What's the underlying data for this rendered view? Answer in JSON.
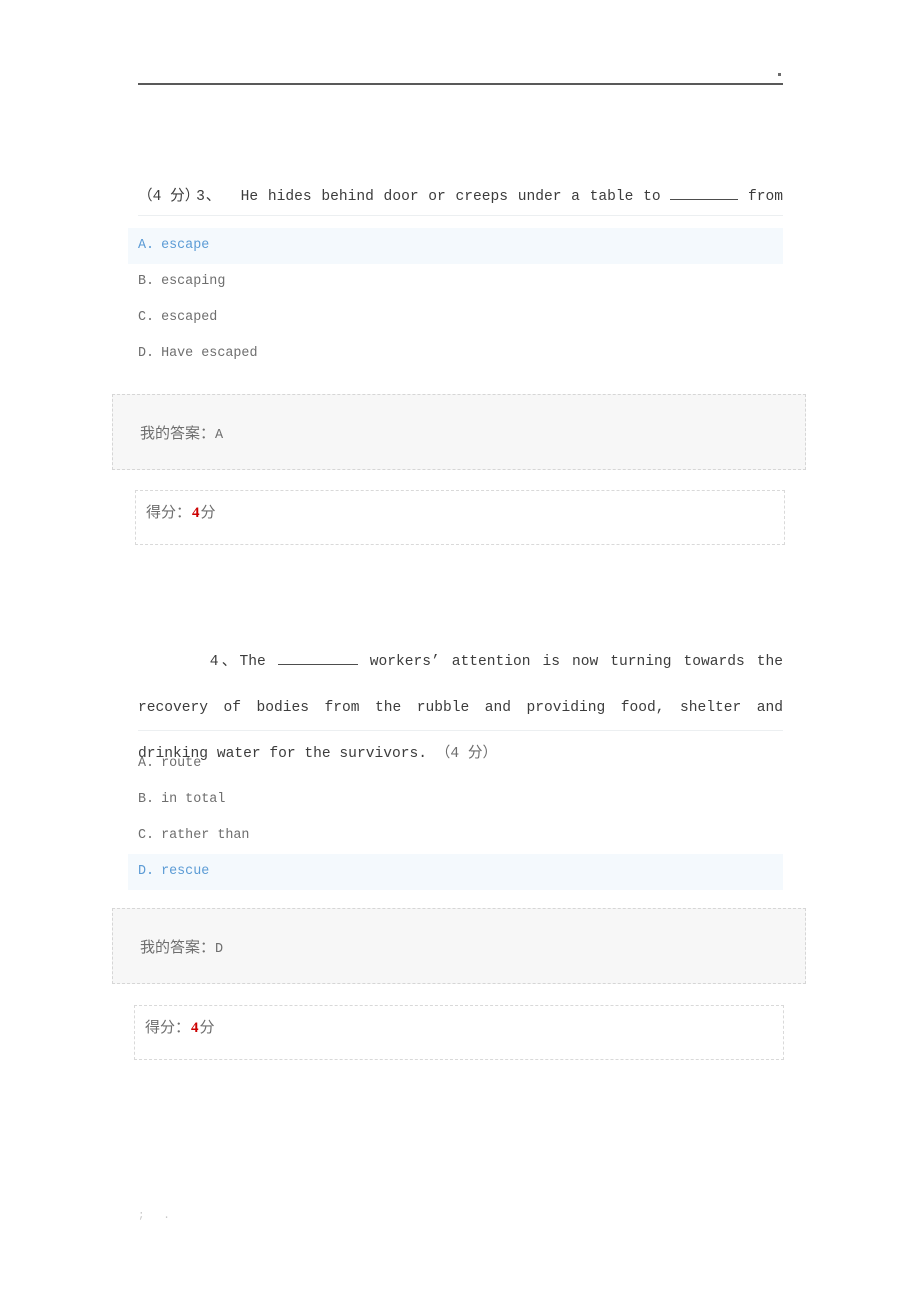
{
  "page": {
    "top_rule": true,
    "stray_dot": ".",
    "bottom_marks": "; ."
  },
  "questions": [
    {
      "number": "3、",
      "stem_before_blank": "  He hides behind door or creeps under a table to ",
      "stem_after_blank": " from his enemies.",
      "points_line": "（4 分）",
      "options": [
        {
          "label": "A.",
          "text": "escape",
          "selected": true
        },
        {
          "label": "B.",
          "text": "escaping",
          "selected": false
        },
        {
          "label": "C.",
          "text": "escaped",
          "selected": false
        },
        {
          "label": "D.",
          "text": "Have escaped",
          "selected": false
        }
      ],
      "my_answer_label": "我的答案：",
      "my_answer_value": "A",
      "score_label": "得分：",
      "score_value": "4",
      "score_unit": "分"
    },
    {
      "number": "4、",
      "stem_before_blank": "The ",
      "stem_after_blank": " workers’ attention is now turning towards the recovery of bodies from the rubble and providing food, shelter and drinking water for the survivors. ",
      "points_line": "（4 分）",
      "options": [
        {
          "label": "A.",
          "text": "route",
          "selected": false
        },
        {
          "label": "B.",
          "text": "in total",
          "selected": false
        },
        {
          "label": "C.",
          "text": "rather than",
          "selected": false
        },
        {
          "label": "D.",
          "text": "rescue",
          "selected": true
        }
      ],
      "my_answer_label": "我的答案：",
      "my_answer_value": "D",
      "score_label": "得分：",
      "score_value": "4",
      "score_unit": "分"
    }
  ],
  "colors": {
    "selected_text": "#5b9bd5",
    "selected_bg": "#f4f9fd",
    "score_number": "#cc0000",
    "answer_bg": "#f7f7f7",
    "body_text": "#3c3c3c"
  }
}
